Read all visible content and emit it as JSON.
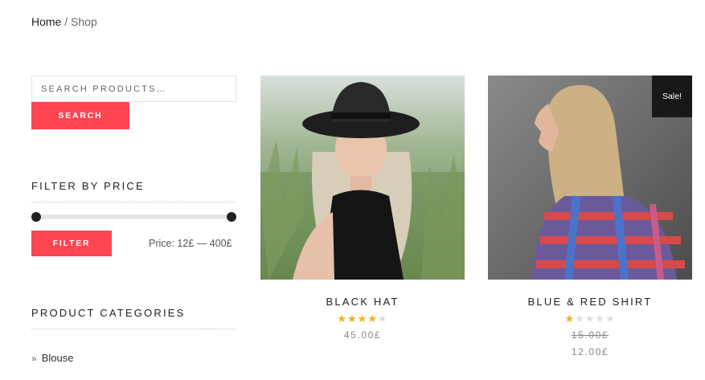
{
  "breadcrumb": {
    "home": "Home",
    "separator": "/",
    "current": "Shop"
  },
  "sidebar": {
    "search": {
      "placeholder": "Search products…",
      "button": "Search"
    },
    "price_filter": {
      "title": "Filter by price",
      "button": "Filter",
      "price_label": "Price: 12£ — 400£",
      "range_min_fraction": 0,
      "range_max_fraction": 1
    },
    "categories": {
      "title": "Product categories",
      "items": [
        {
          "label": "Blouse"
        }
      ]
    }
  },
  "products": [
    {
      "name": "Black Hat",
      "rating": 4,
      "rating_max": 5,
      "price": "45.00£",
      "sale": false
    },
    {
      "name": "Blue & Red Shirt",
      "rating": 1,
      "rating_max": 5,
      "old_price": "15.00£",
      "price": "12.00£",
      "sale": true,
      "badge": "Sale!"
    }
  ],
  "colors": {
    "accent": "#ff4452",
    "star": "#f2b01e",
    "badge_bg": "#181818"
  },
  "icons": {
    "category_bullet": "chevron-right-icon"
  }
}
